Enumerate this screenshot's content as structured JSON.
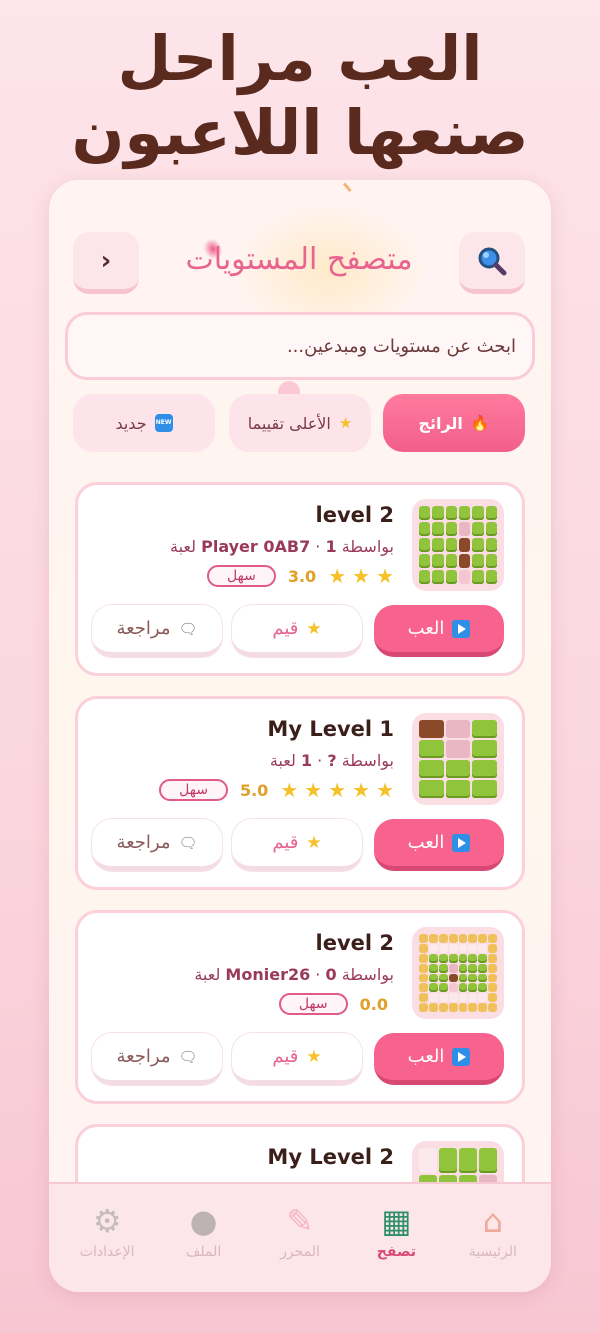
{
  "headline": {
    "line1": "العب مراحل",
    "line2": "صنعها اللاعبون"
  },
  "header": {
    "title": "متصفح المستويات",
    "back_glyph": "›"
  },
  "search": {
    "placeholder": "ابحث عن مستويات ومبدعين..."
  },
  "filters": [
    {
      "label": "الرائج",
      "icon": "fire-icon",
      "active": true
    },
    {
      "label": "الأعلى تقييما",
      "icon": "star-icon",
      "active": false
    },
    {
      "label": "جديد",
      "icon": "new-badge-icon",
      "active": false
    }
  ],
  "new_badge_text": "NEW",
  "levels": [
    {
      "title": "level 2",
      "by_prefix": "بواسطة",
      "author": "Player 0AB7",
      "plays": "1",
      "plays_suffix": "لعبة",
      "stars": 3,
      "score": "3.0",
      "difficulty": "سهل"
    },
    {
      "title": "My Level 1",
      "by_prefix": "بواسطة",
      "author": "?",
      "plays": "1",
      "plays_suffix": "لعبة",
      "stars": 5,
      "score": "5.0",
      "difficulty": "سهل"
    },
    {
      "title": "level 2",
      "by_prefix": "بواسطة",
      "author": "Monier26",
      "plays": "0",
      "plays_suffix": "لعبة",
      "stars": 0,
      "score": "0.0",
      "difficulty": "سهل"
    },
    {
      "title": "My Level 2"
    }
  ],
  "card_actions": {
    "play": "العب",
    "rate": "قيم",
    "review": "مراجعة"
  },
  "nav": [
    {
      "label": "الرئيسية",
      "icon": "house-icon",
      "active": false
    },
    {
      "label": "تصفح",
      "icon": "map-icon",
      "active": true
    },
    {
      "label": "المحرر",
      "icon": "pencil-icon",
      "active": false
    },
    {
      "label": "الملف",
      "icon": "user-icon",
      "active": false
    },
    {
      "label": "الإعدادات",
      "icon": "gear-icon",
      "active": false
    }
  ]
}
